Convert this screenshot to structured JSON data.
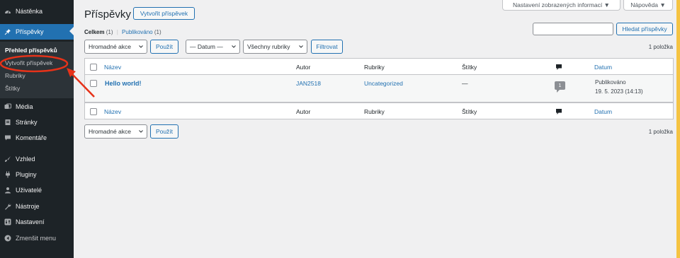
{
  "sidebar": {
    "items": [
      {
        "label": "Nástěnka",
        "icon": "dashboard-icon"
      },
      {
        "label": "Příspěvky",
        "icon": "pin-icon"
      },
      {
        "label": "Média",
        "icon": "media-icon"
      },
      {
        "label": "Stránky",
        "icon": "pages-icon"
      },
      {
        "label": "Komentáře",
        "icon": "comments-icon"
      },
      {
        "label": "Vzhled",
        "icon": "brush-icon"
      },
      {
        "label": "Pluginy",
        "icon": "plugin-icon"
      },
      {
        "label": "Uživatelé",
        "icon": "users-icon"
      },
      {
        "label": "Nástroje",
        "icon": "wrench-icon"
      },
      {
        "label": "Nastavení",
        "icon": "settings-icon"
      },
      {
        "label": "Zmenšit menu",
        "icon": "collapse-icon"
      }
    ],
    "submenu": [
      "Přehled příspěvků",
      "Vytvořit příspěvek",
      "Rubriky",
      "Štítky"
    ]
  },
  "header": {
    "title": "Příspěvky",
    "add_new": "Vytvořit příspěvek",
    "screen_options": "Nastavení zobrazených informací ▼",
    "help": "Nápověda ▼"
  },
  "filters": {
    "all_label": "Celkem",
    "all_count": "(1)",
    "sep": "|",
    "published_label": "Publikováno",
    "published_count": "(1)"
  },
  "search": {
    "button": "Hledat příspěvky",
    "value": ""
  },
  "bulk": {
    "select": "Hromadné akce",
    "apply": "Použít"
  },
  "date_filter": "— Datum —",
  "category_filter": "Všechny rubriky",
  "filter_button": "Filtrovat",
  "items_count": "1 položka",
  "table": {
    "columns": [
      "Název",
      "Autor",
      "Rubriky",
      "Štítky",
      "Datum"
    ],
    "rows": [
      {
        "title": "Hello world!",
        "author": "JAN2518",
        "categories": "Uncategorized",
        "tags": "—",
        "comments": "1",
        "status": "Publikováno",
        "date": "19. 5. 2023 (14:13)"
      }
    ]
  },
  "colors": {
    "accent": "#2271b1",
    "sidebar": "#1d2327",
    "annotation": "#e63219"
  }
}
